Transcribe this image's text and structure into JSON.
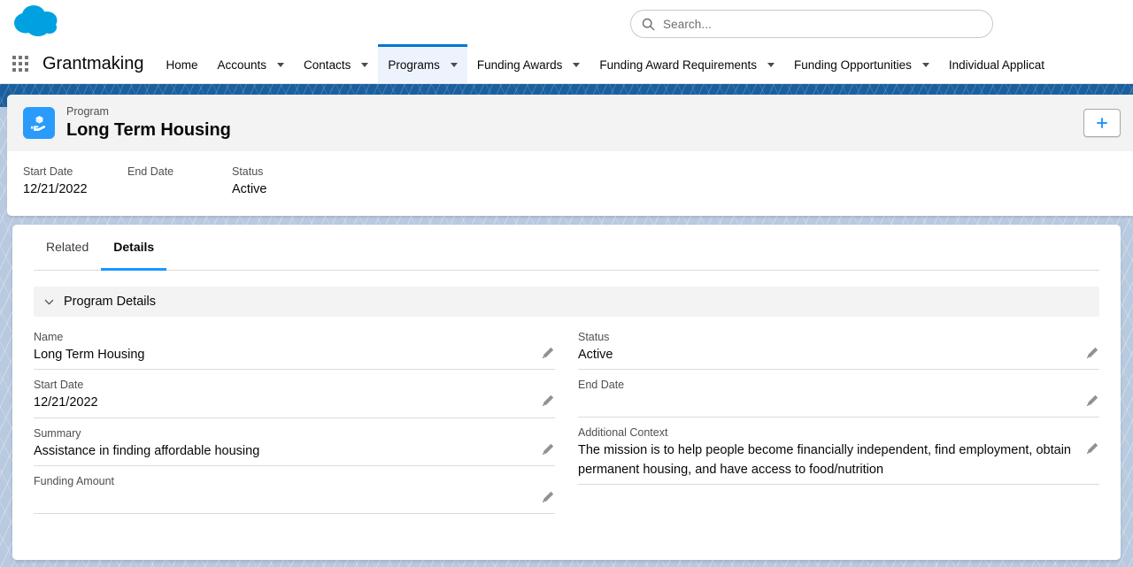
{
  "global": {
    "logo_name": "salesforce-cloud-logo",
    "app_launcher_name": "app-launcher-grid",
    "app_name": "Grantmaking"
  },
  "search": {
    "placeholder": "Search...",
    "value": "",
    "icon": "search-icon"
  },
  "nav": {
    "items": [
      {
        "label": "Home",
        "has_caret": false,
        "active": false
      },
      {
        "label": "Accounts",
        "has_caret": true,
        "active": false
      },
      {
        "label": "Contacts",
        "has_caret": true,
        "active": false
      },
      {
        "label": "Programs",
        "has_caret": true,
        "active": true
      },
      {
        "label": "Funding Awards",
        "has_caret": true,
        "active": false
      },
      {
        "label": "Funding Award Requirements",
        "has_caret": true,
        "active": false
      },
      {
        "label": "Funding Opportunities",
        "has_caret": true,
        "active": false
      },
      {
        "label": "Individual Applicat",
        "has_caret": false,
        "active": false
      }
    ]
  },
  "record": {
    "object_type": "Program",
    "name": "Long Term Housing",
    "icon": "program-box-in-hand-icon",
    "icon_color": "#2a9bfa",
    "new_button_label": "+",
    "highlights": [
      {
        "label": "Start Date",
        "value": "12/21/2022"
      },
      {
        "label": "End Date",
        "value": ""
      },
      {
        "label": "Status",
        "value": "Active"
      }
    ]
  },
  "tabs": [
    {
      "label": "Related",
      "active": false
    },
    {
      "label": "Details",
      "active": true
    }
  ],
  "details": {
    "section_title": "Program Details",
    "collapsed": false,
    "left_fields": [
      {
        "label": "Name",
        "value": "Long Term Housing"
      },
      {
        "label": "Start Date",
        "value": "12/21/2022"
      },
      {
        "label": "Summary",
        "value": "Assistance in finding affordable housing"
      },
      {
        "label": "Funding Amount",
        "value": ""
      }
    ],
    "right_fields": [
      {
        "label": "Status",
        "value": "Active"
      },
      {
        "label": "End Date",
        "value": ""
      },
      {
        "label": "Additional Context",
        "value": "The mission is to help people become financially independent, find employment, obtain permanent housing, and have access to food/nutrition"
      }
    ]
  },
  "colors": {
    "brand_blue": "#0176d3",
    "accent_blue": "#1b96ff",
    "icon_blue": "#2a9bfa",
    "banner_blue": "#1b5f9e",
    "page_bg": "#b8c9e0"
  }
}
